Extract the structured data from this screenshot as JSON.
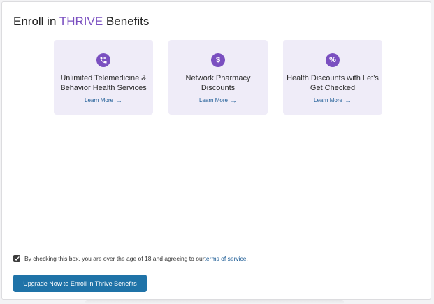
{
  "header": {
    "title_prefix": "Enroll in ",
    "brand": "THRIVE",
    "title_suffix": " Benefits"
  },
  "cards": [
    {
      "title": "Unlimited Telemedicine & Behavior Health Services",
      "link": "Learn More",
      "icon": "phone-plus-icon"
    },
    {
      "title": "Network Pharmacy Discounts",
      "link": "Learn More",
      "icon": "dollar-icon"
    },
    {
      "title": "Health Discounts with Let’s Get Checked",
      "link": "Learn More",
      "icon": "percent-icon"
    }
  ],
  "consent": {
    "checked": true,
    "text": "By checking this box, you are over the age of 18 and agreeing to our ",
    "link": "terms of service",
    "period": "."
  },
  "cta": {
    "label": "Upgrade Now to Enroll in Thrive Benefits"
  },
  "colors": {
    "brand": "#7a4fc0",
    "card_bg": "#efecf8",
    "link": "#1a5a94",
    "button": "#1f73a8"
  }
}
